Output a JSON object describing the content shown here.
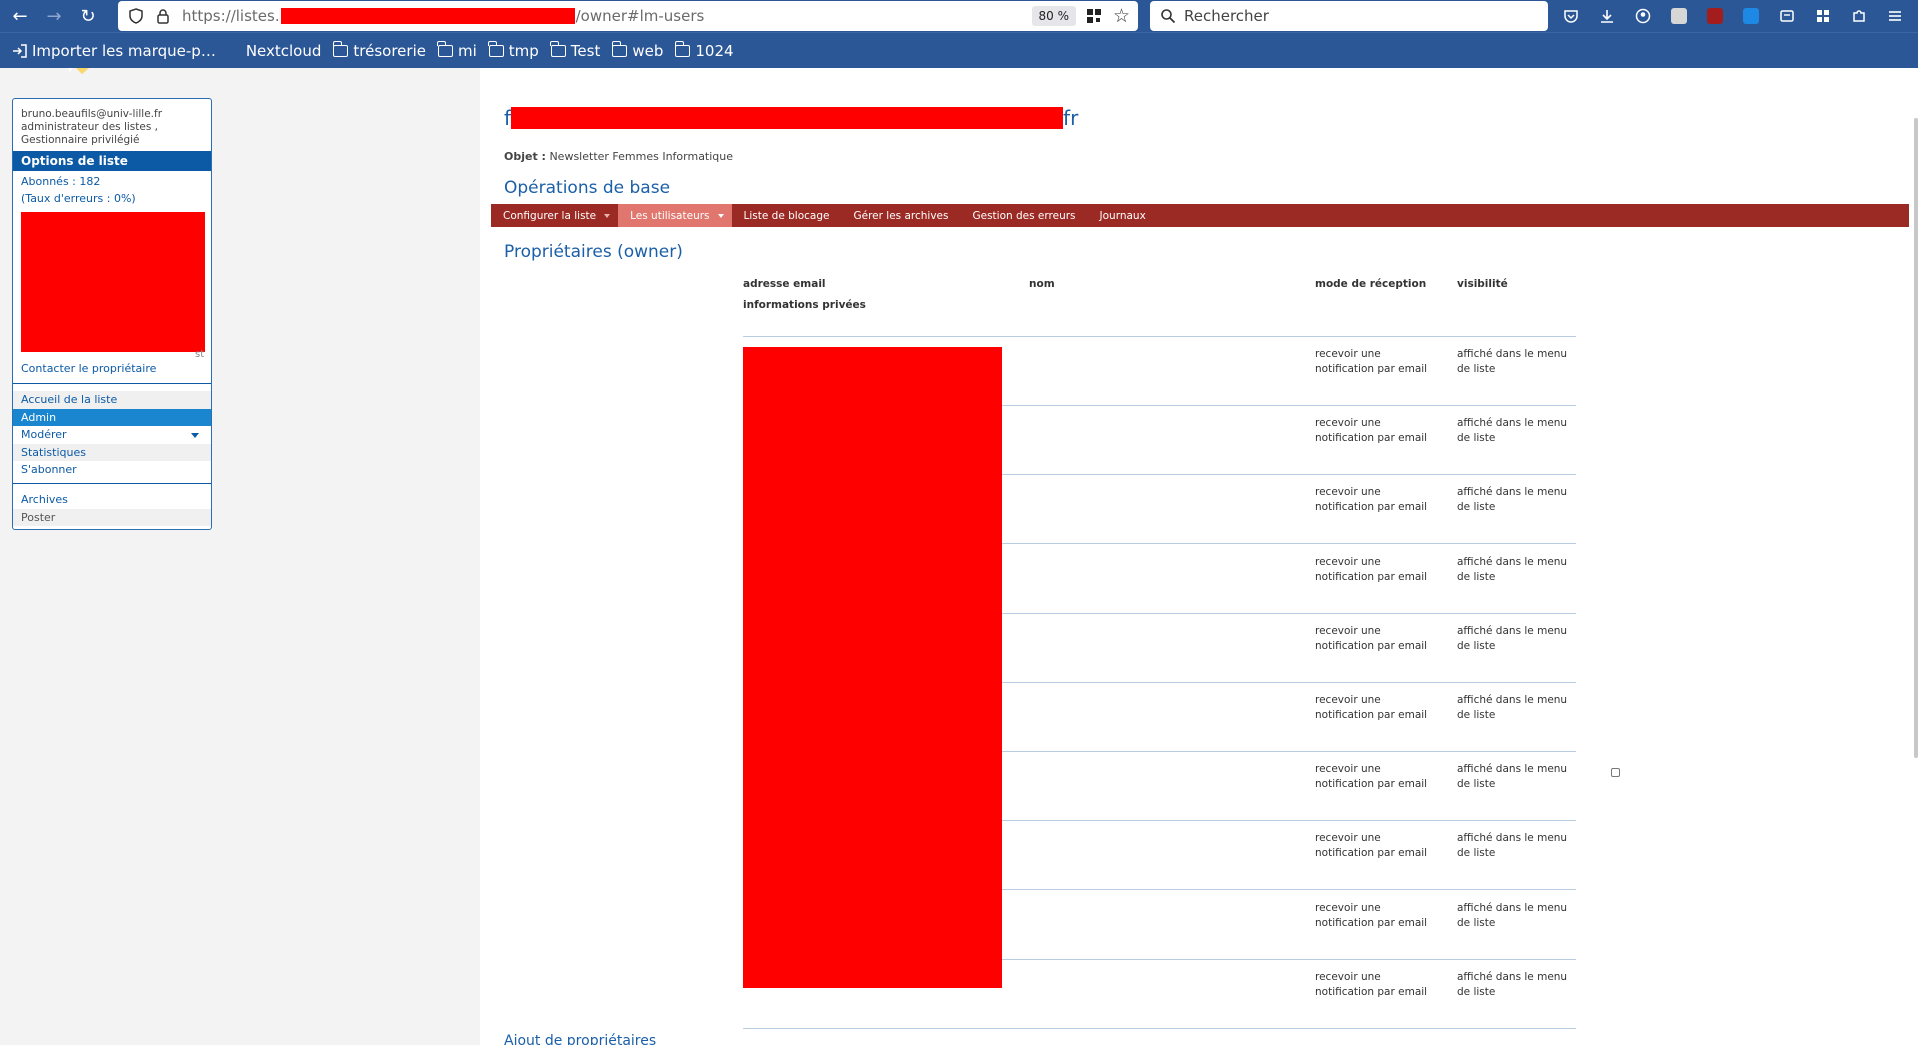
{
  "browser": {
    "url_prefix": "https://listes.",
    "url_suffix": "/owner#lm-users",
    "zoom": "80 %",
    "search_placeholder": "Rechercher"
  },
  "bookmarks": [
    {
      "label": "Importer les marque-p…",
      "kind": "import"
    },
    {
      "label": "Nextcloud",
      "kind": "plain"
    },
    {
      "label": "trésorerie",
      "kind": "folder"
    },
    {
      "label": "mi",
      "kind": "folder"
    },
    {
      "label": "tmp",
      "kind": "folder"
    },
    {
      "label": "Test",
      "kind": "folder"
    },
    {
      "label": "web",
      "kind": "folder"
    },
    {
      "label": "1024",
      "kind": "folder"
    }
  ],
  "sidebar": {
    "user_email": "bruno.beaufils@univ-lille.fr",
    "user_role_1": "administrateur des listes ,",
    "user_role_2": "Gestionnaire privilégié",
    "options_title": "Options de liste",
    "subscribers": "Abonnés : 182",
    "error_rate": "(Taux d'erreurs : 0%)",
    "stray_text": "st",
    "contact_owner": "Contacter le propriétaire",
    "nav": [
      {
        "label": "Accueil de la liste",
        "state": "alt"
      },
      {
        "label": "Admin",
        "state": "active"
      },
      {
        "label": "Modérer",
        "state": "caret"
      },
      {
        "label": "Statistiques",
        "state": "alt"
      },
      {
        "label": "S'abonner",
        "state": "normal"
      }
    ],
    "archives": "Archives",
    "post": "Poster"
  },
  "main": {
    "title_prefix": "f",
    "title_suffix": "fr",
    "objet_label": "Objet :",
    "objet_value": "Newsletter Femmes Informatique",
    "section_ops": "Opérations de base",
    "menu": [
      {
        "label": "Configurer la liste",
        "caret": true,
        "active": false
      },
      {
        "label": "Les utilisateurs",
        "caret": true,
        "active": true
      },
      {
        "label": "Liste de blocage",
        "caret": false,
        "active": false
      },
      {
        "label": "Gérer les archives",
        "caret": false,
        "active": false
      },
      {
        "label": "Gestion des erreurs",
        "caret": false,
        "active": false
      },
      {
        "label": "Journaux",
        "caret": false,
        "active": false
      }
    ],
    "section_owners": "Propriétaires (owner)",
    "columns": {
      "email": "adresse email",
      "name": "nom",
      "reception": "mode de réception",
      "visibility": "visibilité",
      "private_info": "informations privées"
    },
    "rows": [
      {
        "reception": "recevoir une notification par email",
        "visibility": "affiché dans le menu de liste",
        "checkbox": false
      },
      {
        "reception": "recevoir une notification par email",
        "visibility": "affiché dans le menu de liste",
        "checkbox": false
      },
      {
        "reception": "recevoir une notification par email",
        "visibility": "affiché dans le menu de liste",
        "checkbox": false
      },
      {
        "reception": "recevoir une notification par email",
        "visibility": "affiché dans le menu de liste",
        "checkbox": false
      },
      {
        "reception": "recevoir une notification par email",
        "visibility": "affiché dans le menu de liste",
        "checkbox": false
      },
      {
        "reception": "recevoir une notification par email",
        "visibility": "affiché dans le menu de liste",
        "checkbox": false
      },
      {
        "reception": "recevoir une notification par email",
        "visibility": "affiché dans le menu de liste",
        "checkbox": true
      },
      {
        "reception": "recevoir une notification par email",
        "visibility": "affiché dans le menu de liste",
        "checkbox": false
      },
      {
        "reception": "recevoir une notification par email",
        "visibility": "affiché dans le menu de liste",
        "checkbox": false
      },
      {
        "reception": "recevoir une notification par email",
        "visibility": "affiché dans le menu de liste",
        "checkbox": false
      }
    ],
    "section_add": "Ajout de propriétaires"
  },
  "colors": {
    "chrome": "#2b5797",
    "accent": "#1a5fa8",
    "menubar": "#9c2a24",
    "menu_active": "#e0766d",
    "redaction": "#ff0000"
  }
}
